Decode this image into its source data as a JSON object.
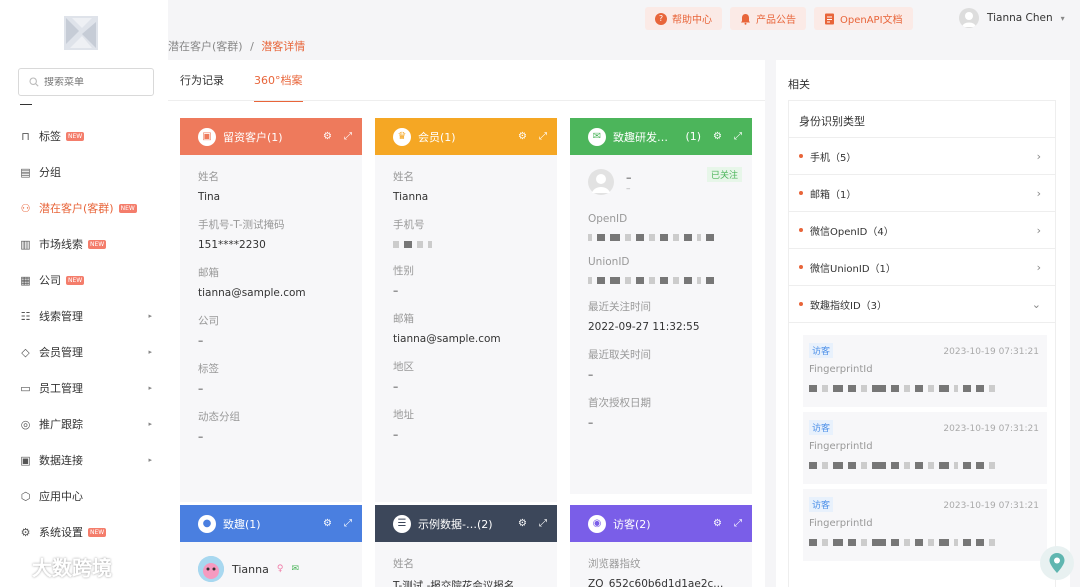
{
  "sidebar": {
    "search_placeholder": "搜索菜单",
    "items": [
      {
        "label": "标签",
        "new": true,
        "icon": "bookmark-icon",
        "caret": false
      },
      {
        "label": "分组",
        "new": false,
        "icon": "folder-icon",
        "caret": false
      },
      {
        "label": "潜在客户(客群)",
        "new": true,
        "icon": "users-icon",
        "caret": false,
        "active": true
      },
      {
        "label": "市场线索",
        "new": true,
        "icon": "chart-icon",
        "caret": false
      },
      {
        "label": "公司",
        "new": true,
        "icon": "building-icon",
        "caret": false
      },
      {
        "label": "线索管理",
        "new": false,
        "icon": "checklist-icon",
        "caret": true
      },
      {
        "label": "会员管理",
        "new": false,
        "icon": "diamond-icon",
        "caret": true
      },
      {
        "label": "员工管理",
        "new": false,
        "icon": "id-card-icon",
        "caret": true
      },
      {
        "label": "推广跟踪",
        "new": false,
        "icon": "target-icon",
        "caret": true
      },
      {
        "label": "数据连接",
        "new": false,
        "icon": "database-icon",
        "caret": true
      },
      {
        "label": "应用中心",
        "new": false,
        "icon": "hexagon-icon",
        "caret": false
      },
      {
        "label": "系统设置",
        "new": true,
        "icon": "settings-icon",
        "caret": false
      }
    ],
    "new_badge": "NEW",
    "watermark": "大数跨境"
  },
  "topbar": {
    "help": "帮助中心",
    "announcement": "产品公告",
    "openapi": "OpenAPI文档",
    "user_name": "Tianna Chen"
  },
  "breadcrumb": {
    "parent": "潜在客户(客群)",
    "separator": "/",
    "current": "潜客详情"
  },
  "tabs": {
    "behavior": "行为记录",
    "profile": "360°档案"
  },
  "cards": {
    "leads": {
      "title": "留资客户(1)",
      "color": "#ee7a5c",
      "fields": [
        {
          "label": "姓名",
          "value": "Tina"
        },
        {
          "label": "手机号-T-测试掩码",
          "value": "151****2230"
        },
        {
          "label": "邮箱",
          "value": "tianna@sample.com"
        },
        {
          "label": "公司",
          "value": "–"
        },
        {
          "label": "标签",
          "value": "–"
        },
        {
          "label": "动态分组",
          "value": "–"
        }
      ]
    },
    "member": {
      "title": "会员(1)",
      "color": "#f5a724",
      "fields": [
        {
          "label": "姓名",
          "value": "Tianna"
        },
        {
          "label": "手机号",
          "value": ""
        },
        {
          "label": "性别",
          "value": "–"
        },
        {
          "label": "邮箱",
          "value": "tianna@sample.com"
        },
        {
          "label": "地区",
          "value": "–"
        },
        {
          "label": "地址",
          "value": "–"
        }
      ]
    },
    "wechat": {
      "title": "致趣研发…",
      "count": "(1)",
      "color": "#4cb55b",
      "followed": "已关注",
      "nick": "–",
      "sub": "–",
      "fields": [
        {
          "label": "OpenID",
          "value": ""
        },
        {
          "label": "UnionID",
          "value": ""
        },
        {
          "label": "最近关注时间",
          "value": "2022-09-27 11:32:55"
        },
        {
          "label": "最近取关时间",
          "value": "–"
        },
        {
          "label": "首次授权日期",
          "value": "–"
        }
      ]
    },
    "zhiqu": {
      "title": "致趣(1)",
      "color": "#4a7fe0",
      "name": "Tianna"
    },
    "sample": {
      "title": "示例数据-…(2)",
      "color": "#3c475a",
      "field_label": "姓名",
      "field_value": "T-测试 -报交院花会议报名"
    },
    "visitor": {
      "title": "访客(2)",
      "color": "#7a5ee8",
      "field_label": "浏览器指纹",
      "field_value": "ZQ_652c60b6d1d1ae2c..."
    }
  },
  "right_panel": {
    "title": "相关",
    "box_title": "身份识别类型",
    "items": [
      {
        "label": "手机（5）",
        "chev": "›"
      },
      {
        "label": "邮箱（1）",
        "chev": "›"
      },
      {
        "label": "微信OpenID（4）",
        "chev": "›"
      },
      {
        "label": "微信UnionID（1）",
        "chev": "›"
      },
      {
        "label": "致趣指纹ID（3）",
        "chev": "⌄"
      }
    ],
    "fingerprints": [
      {
        "tag": "访客",
        "time": "2023-10-19 07:31:21",
        "label": "FingerprintId"
      },
      {
        "tag": "访客",
        "time": "2023-10-19 07:31:21",
        "label": "FingerprintId"
      },
      {
        "tag": "访客",
        "time": "2023-10-19 07:31:21",
        "label": "FingerprintId"
      }
    ]
  }
}
